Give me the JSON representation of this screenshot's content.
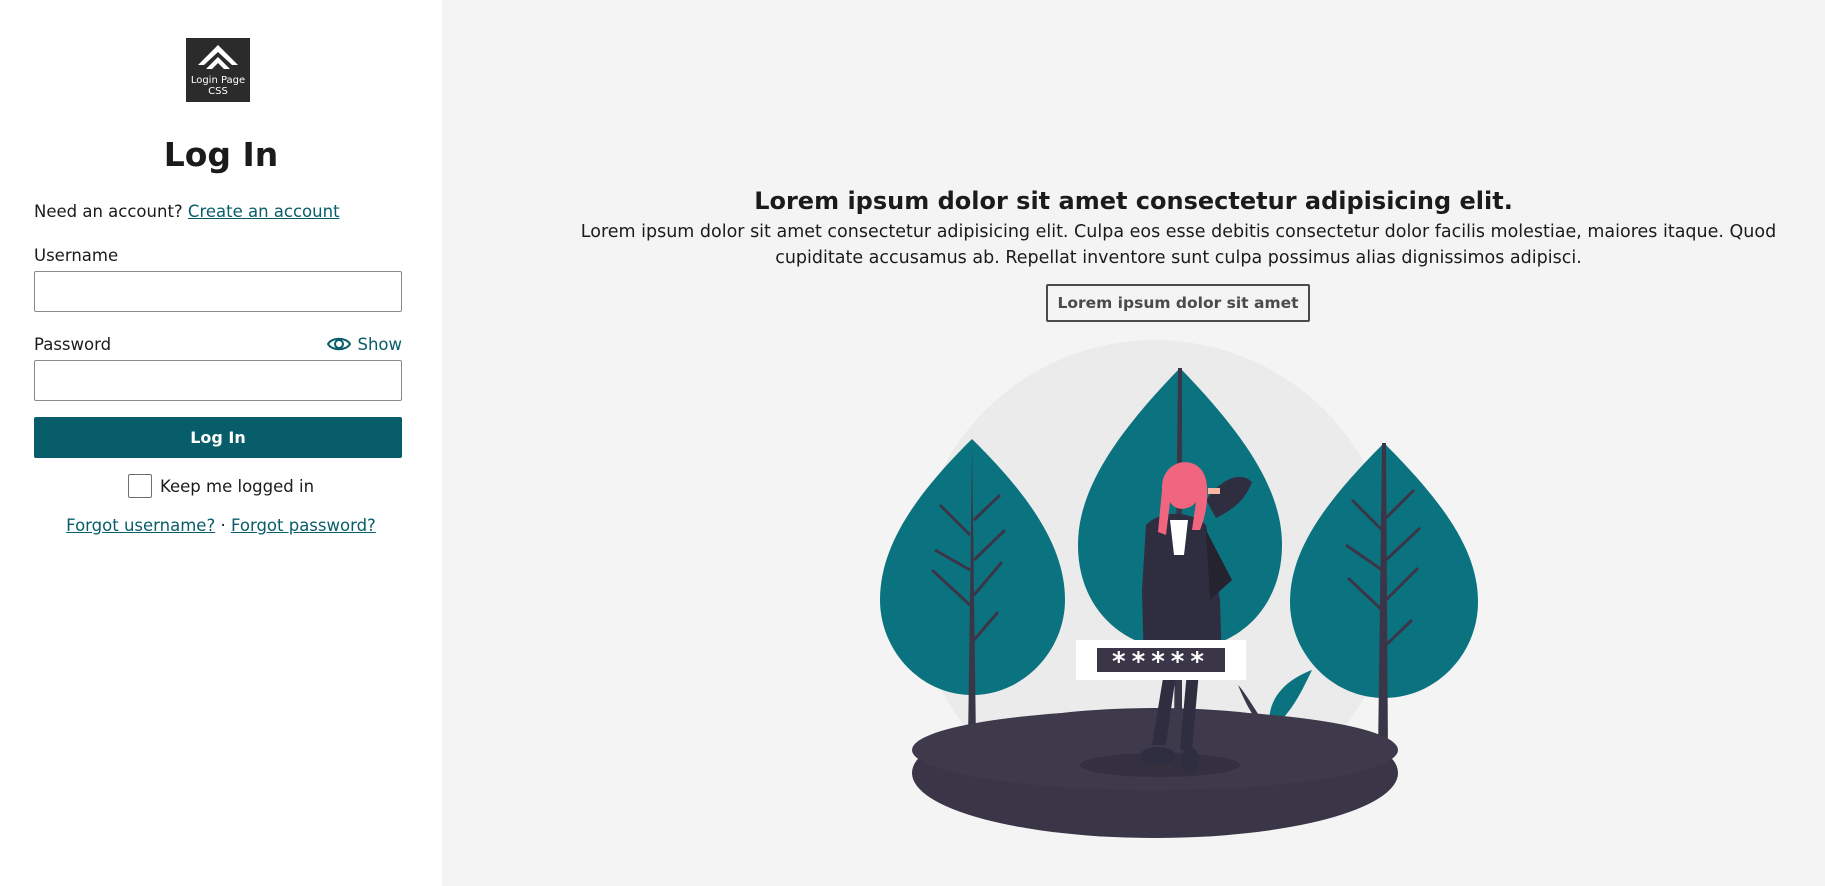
{
  "logo": {
    "text": "Login Page CSS",
    "icon": "chevron-up-double-icon"
  },
  "login": {
    "title": "Log In",
    "need_account": "Need an account?",
    "create_account": "Create an account",
    "username_label": "Username",
    "username_value": "",
    "password_label": "Password",
    "password_value": "",
    "show_label": "Show",
    "show_icon": "eye-icon",
    "submit": "Log In",
    "keep_logged_in": "Keep me logged in",
    "keep_logged_in_checked": false,
    "forgot_username": "Forgot username?",
    "separator": "·",
    "forgot_password": "Forgot password?"
  },
  "hero": {
    "title": "Lorem ipsum dolor sit amet consectetur adipisicing elit.",
    "text": "Lorem ipsum dolor sit amet consectetur adipisicing elit. Culpa eos esse debitis consectetur dolor facilis molestiae, maiores itaque. Quod cupiditate accusamus ab. Repellat inventore sunt culpa possimus alias dignissimos adipisci.",
    "button": "Lorem ipsum dolor sit amet",
    "illustration_password": "*****"
  },
  "colors": {
    "accent": "#075d6a",
    "tree": "#0b7380",
    "ground": "#3a3648",
    "hair": "#f2657f",
    "panel_bg": "#f4f4f4"
  }
}
